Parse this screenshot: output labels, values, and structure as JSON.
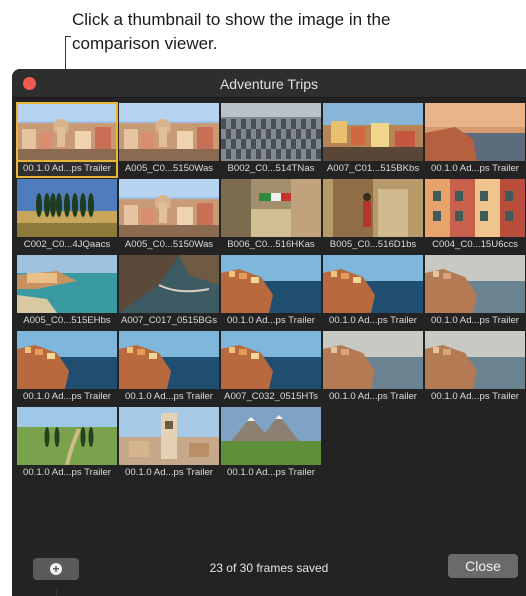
{
  "callout_top": "Click a thumbnail to show the image in the comparison viewer.",
  "window": {
    "title": "Adventure Trips"
  },
  "thumbnails": [
    {
      "label": "00.1.0 Ad...ps Trailer",
      "scene": "village-dome",
      "selected": true
    },
    {
      "label": "A005_C0...5150Was",
      "scene": "village-dome"
    },
    {
      "label": "B002_C0...514TNas",
      "scene": "checker-floor"
    },
    {
      "label": "A007_C01...515BKbs",
      "scene": "cliff-houses"
    },
    {
      "label": "00.1.0 Ad...ps Trailer",
      "scene": "sunset-coast"
    },
    {
      "label": "C002_C0...4JQaacs",
      "scene": "cypress-field"
    },
    {
      "label": "A005_C0...5150Was",
      "scene": "village-dome"
    },
    {
      "label": "B006_C0...516HKas",
      "scene": "alley-flag"
    },
    {
      "label": "B005_C0...516D1bs",
      "scene": "walker-door"
    },
    {
      "label": "C004_C0...15U6ccs",
      "scene": "colorful-facades"
    },
    {
      "label": "A005_C0...515EHbs",
      "scene": "bay-town"
    },
    {
      "label": "A007_C017_0515BGs",
      "scene": "rocky-cove"
    },
    {
      "label": "00.1.0 Ad...ps Trailer",
      "scene": "cliff-sea"
    },
    {
      "label": "00.1.0 Ad...ps Trailer",
      "scene": "cliff-sea"
    },
    {
      "label": "00.1.0 Ad...ps Trailer",
      "scene": "cliff-sea-faded"
    },
    {
      "label": "00.1.0 Ad...ps Trailer",
      "scene": "cliff-sea"
    },
    {
      "label": "00.1.0 Ad...ps Trailer",
      "scene": "cliff-sea"
    },
    {
      "label": "A007_C032_0515HTs",
      "scene": "cliff-sea"
    },
    {
      "label": "00.1.0 Ad...ps Trailer",
      "scene": "cliff-sea-faded"
    },
    {
      "label": "00.1.0 Ad...ps Trailer",
      "scene": "cliff-sea-faded"
    },
    {
      "label": "00.1.0 Ad...ps Trailer",
      "scene": "cypress-road"
    },
    {
      "label": "00.1.0 Ad...ps Trailer",
      "scene": "tower-town"
    },
    {
      "label": "00.1.0 Ad...ps Trailer",
      "scene": "mountain-meadow"
    }
  ],
  "footer": {
    "add_icon": "plus-circle-icon",
    "status": "23 of 30 frames saved",
    "close_label": "Close"
  },
  "colors": {
    "selection": "#e8b43a",
    "window_bg": "#232323",
    "close_dot": "#ee5a52"
  }
}
